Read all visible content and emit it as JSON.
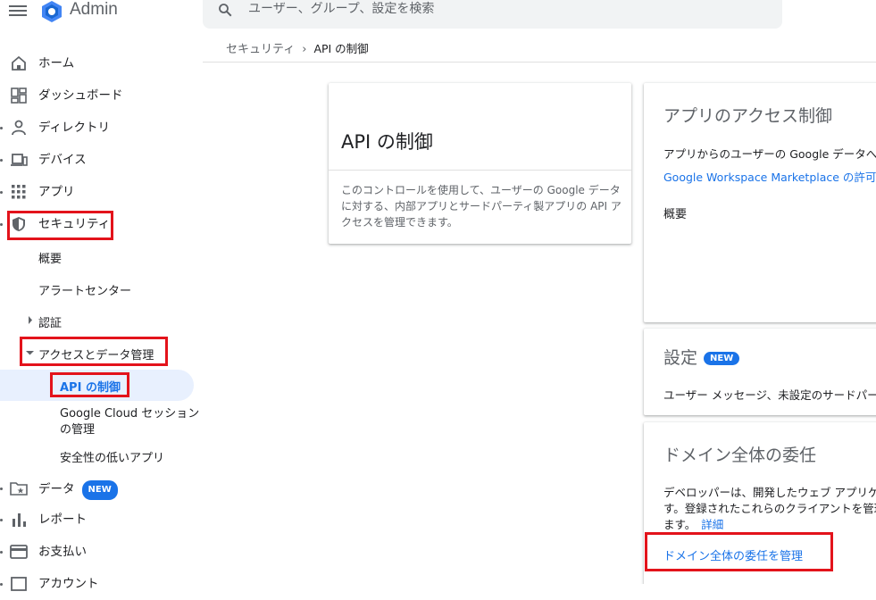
{
  "header": {
    "app_title": "Admin",
    "search_placeholder": "ユーザー、グループ、設定を検索",
    "logo_color": "#4285f4"
  },
  "breadcrumb": {
    "parent": "セキュリティ",
    "separator": "›",
    "current": "API の制御"
  },
  "sidebar": {
    "items": [
      {
        "label": "ホーム",
        "icon": "home-icon"
      },
      {
        "label": "ダッシュボード",
        "icon": "dashboard-icon"
      },
      {
        "label": "ディレクトリ",
        "icon": "person-icon"
      },
      {
        "label": "デバイス",
        "icon": "devices-icon"
      },
      {
        "label": "アプリ",
        "icon": "apps-grid-icon"
      },
      {
        "label": "セキュリティ",
        "icon": "shield-icon"
      },
      {
        "label": "データ",
        "icon": "folder-star-icon",
        "badge": "NEW"
      },
      {
        "label": "レポート",
        "icon": "bar-chart-icon"
      },
      {
        "label": "お支払い",
        "icon": "credit-card-icon"
      },
      {
        "label": "アカウント",
        "icon": "account-icon"
      }
    ],
    "security_sub": {
      "overview": "概要",
      "alert_center": "アラートセンター",
      "auth": "認証",
      "access_data": "アクセスとデータ管理",
      "api_control": "API の制御",
      "cloud_session_line1": "Google Cloud セッション",
      "cloud_session_line2": "の管理",
      "less_secure": "安全性の低いアプリ"
    }
  },
  "cards": {
    "api": {
      "title": "API の制御",
      "description": "このコントロールを使用して、ユーザーの Google データに対する、内部アプリとサードパーティ製アプリの API アクセスを管理できます。"
    },
    "app_access": {
      "title": "アプリのアクセス制御",
      "text": "アプリからのユーザーの Google データへの",
      "link": "Google Workspace Marketplace の許可リスト",
      "overview": "概要"
    },
    "settings": {
      "title": "設定",
      "badge": "NEW",
      "text": "ユーザー メッセージ、未設定のサードパーティ"
    },
    "domain": {
      "title": "ドメイン全体の委任",
      "text_line1": "デベロッパーは、開発したウェブ アプリケーション",
      "text_line2": "す。登録されたこれらのクライアントを管理",
      "text_line3": "ます。",
      "detail_link": "詳細",
      "manage_link": "ドメイン全体の委任を管理"
    }
  },
  "colors": {
    "accent": "#1a73e8",
    "highlight_box": "#e3131b",
    "active_bg": "#e8f0fe"
  }
}
